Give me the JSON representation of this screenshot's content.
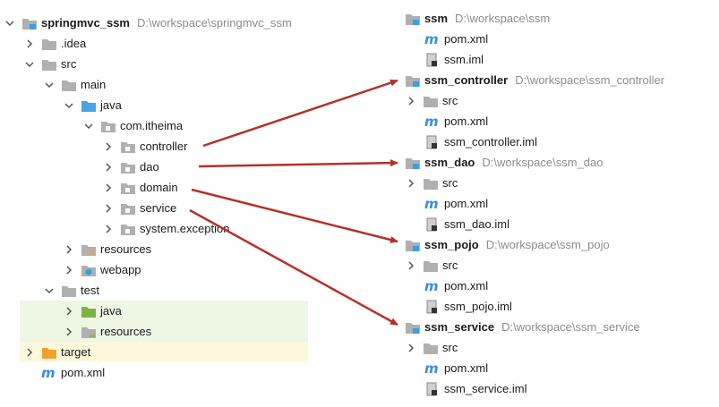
{
  "left_tree": {
    "root": {
      "name": "springmvc_ssm",
      "path": "D:\\workspace\\springmvc_ssm"
    },
    "idea": ".idea",
    "src": "src",
    "main": "main",
    "java": "java",
    "package": "com.itheima",
    "controller": "controller",
    "dao": "dao",
    "domain": "domain",
    "service": "service",
    "system_exception": "system.exception",
    "resources": "resources",
    "webapp": "webapp",
    "test": "test",
    "test_java": "java",
    "test_resources": "resources",
    "target": "target",
    "pom": "pom.xml"
  },
  "right_tree": {
    "ssm": {
      "name": "ssm",
      "path": "D:\\workspace\\ssm",
      "pom": "pom.xml",
      "iml": "ssm.iml"
    },
    "ssm_controller": {
      "name": "ssm_controller",
      "path": "D:\\workspace\\ssm_controller",
      "src": "src",
      "pom": "pom.xml",
      "iml": "ssm_controller.iml"
    },
    "ssm_dao": {
      "name": "ssm_dao",
      "path": "D:\\workspace\\ssm_dao",
      "src": "src",
      "pom": "pom.xml",
      "iml": "ssm_dao.iml"
    },
    "ssm_pojo": {
      "name": "ssm_pojo",
      "path": "D:\\workspace\\ssm_pojo",
      "src": "src",
      "pom": "pom.xml",
      "iml": "ssm_pojo.iml"
    },
    "ssm_service": {
      "name": "ssm_service",
      "path": "D:\\workspace\\ssm_service",
      "src": "src",
      "pom": "pom.xml",
      "iml": "ssm_service.iml"
    }
  },
  "colors": {
    "arrow": "#b5302a",
    "folder": "#b0b0b0",
    "module_badge": "#3aa0e0",
    "source_folder": "#7cb342",
    "target_folder": "#f0a030",
    "maven_icon": "#3c8dde",
    "path_text": "#8c8c8c"
  }
}
